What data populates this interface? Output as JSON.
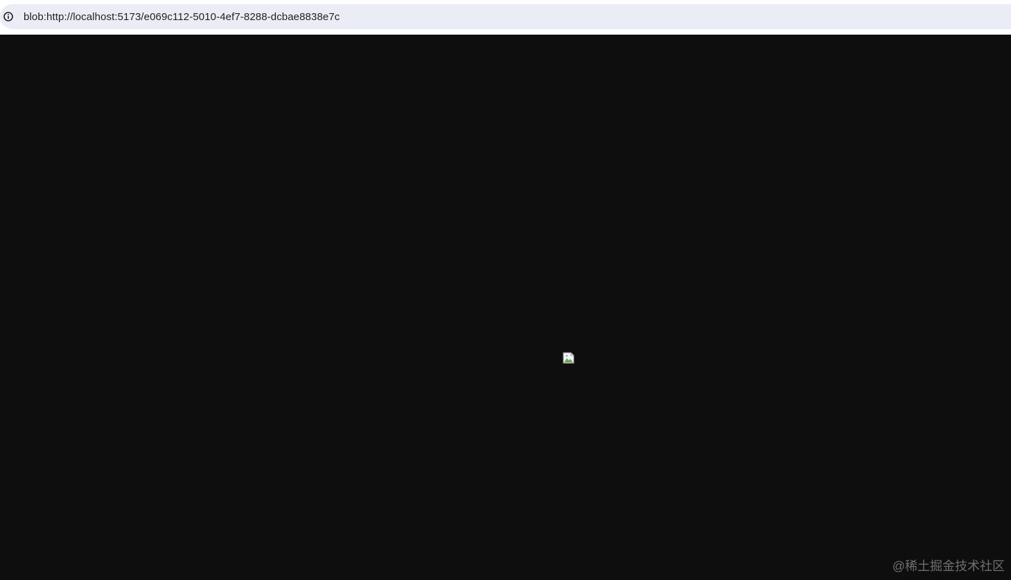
{
  "address_bar": {
    "url": "blob:http://localhost:5173/e069c112-5010-4ef7-8288-dcbae8838e7c",
    "site_info_icon": "info-icon"
  },
  "content": {
    "background_color": "#0e0e0e",
    "image_icon": "broken-image-icon"
  },
  "watermark": {
    "text": "@稀土掘金技术社区"
  }
}
